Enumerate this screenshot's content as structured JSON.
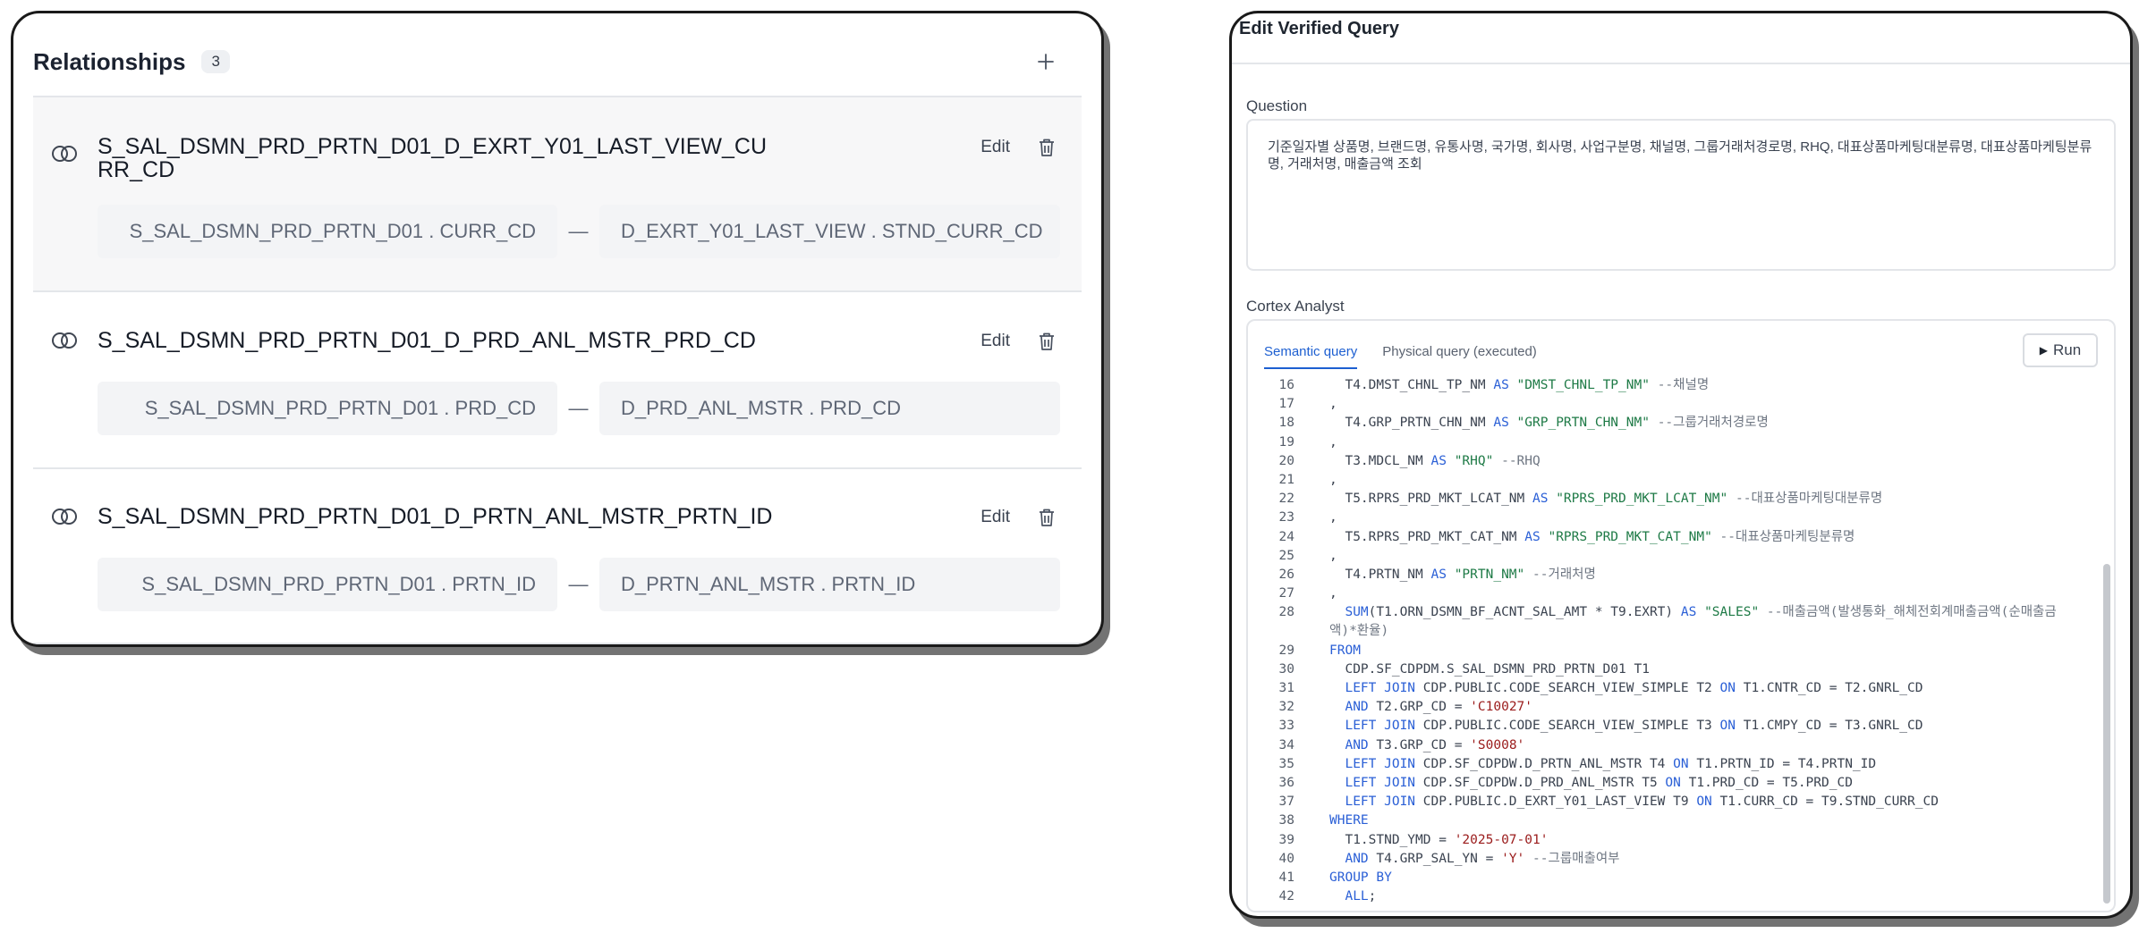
{
  "relationships": {
    "title": "Relationships",
    "count": "3",
    "items": [
      {
        "name": "S_SAL_DSMN_PRD_PRTN_D01_D_EXRT_Y01_LAST_VIEW_CURR_CD",
        "edit_label": "Edit",
        "left": "S_SAL_DSMN_PRD_PRTN_D01 . CURR_CD",
        "sep": "—",
        "right": "D_EXRT_Y01_LAST_VIEW . STND_CURR_CD"
      },
      {
        "name": "S_SAL_DSMN_PRD_PRTN_D01_D_PRD_ANL_MSTR_PRD_CD",
        "edit_label": "Edit",
        "left": "S_SAL_DSMN_PRD_PRTN_D01 . PRD_CD",
        "sep": "—",
        "right": "D_PRD_ANL_MSTR . PRD_CD"
      },
      {
        "name": "S_SAL_DSMN_PRD_PRTN_D01_D_PRTN_ANL_MSTR_PRTN_ID",
        "edit_label": "Edit",
        "left": "S_SAL_DSMN_PRD_PRTN_D01 . PRTN_ID",
        "sep": "—",
        "right": "D_PRTN_ANL_MSTR . PRTN_ID"
      }
    ]
  },
  "editor": {
    "title": "Edit Verified Query",
    "question_label": "Question",
    "question_text": "기준일자별 상품명, 브랜드명, 유통사명, 국가명, 회사명, 사업구분명, 채널명, 그룹거래처경로명, RHQ, 대표상품마케팅대분류명, 대표상품마케팅분류명, 거래처명, 매출금액 조회",
    "analyst_label": "Cortex Analyst",
    "tab_semantic": "Semantic query",
    "tab_physical": "Physical query (executed)",
    "run_label": "Run",
    "code_lines": [
      {
        "n": "16",
        "html": "  T4.DMST_CHNL_TP_NM <span class=\"kw\">AS</span> <span class=\"str\">\"DMST_CHNL_TP_NM\"</span> <span class=\"cmt\">--채널명</span>"
      },
      {
        "n": "17",
        "html": ","
      },
      {
        "n": "18",
        "html": "  T4.GRP_PRTN_CHN_NM <span class=\"kw\">AS</span> <span class=\"str\">\"GRP_PRTN_CHN_NM\"</span> <span class=\"cmt\">--그룹거래처경로명</span>"
      },
      {
        "n": "19",
        "html": ","
      },
      {
        "n": "20",
        "html": "  T3.MDCL_NM <span class=\"kw\">AS</span> <span class=\"str\">\"RHQ\"</span> <span class=\"cmt\">--RHQ</span>"
      },
      {
        "n": "21",
        "html": ","
      },
      {
        "n": "22",
        "html": "  T5.RPRS_PRD_MKT_LCAT_NM <span class=\"kw\">AS</span> <span class=\"str\">\"RPRS_PRD_MKT_LCAT_NM\"</span> <span class=\"cmt\">--대표상품마케팅대분류명</span>"
      },
      {
        "n": "23",
        "html": ","
      },
      {
        "n": "24",
        "html": "  T5.RPRS_PRD_MKT_CAT_NM <span class=\"kw\">AS</span> <span class=\"str\">\"RPRS_PRD_MKT_CAT_NM\"</span> <span class=\"cmt\">--대표상품마케팅분류명</span>"
      },
      {
        "n": "25",
        "html": ","
      },
      {
        "n": "26",
        "html": "  T4.PRTN_NM <span class=\"kw\">AS</span> <span class=\"str\">\"PRTN_NM\"</span> <span class=\"cmt\">--거래처명</span>"
      },
      {
        "n": "27",
        "html": ","
      },
      {
        "n": "28",
        "html": "  <span class=\"kw\">SUM</span>(T1.ORN_DSMN_BF_ACNT_SAL_AMT * T9.EXRT) <span class=\"kw\">AS</span> <span class=\"str\">\"SALES\"</span> <span class=\"cmt\">--매출금액(발생통화_해체전회계매출금액(순매출금액)*환율)</span>",
        "tall": true
      },
      {
        "n": "29",
        "html": "<span class=\"kw\">FROM</span>"
      },
      {
        "n": "30",
        "html": "  CDP.SF_CDPDM.S_SAL_DSMN_PRD_PRTN_D01 T1"
      },
      {
        "n": "31",
        "html": "  <span class=\"kw\">LEFT JOIN</span> CDP.PUBLIC.CODE_SEARCH_VIEW_SIMPLE T2 <span class=\"kw\">ON</span> T1.CNTR_CD = T2.GNRL_CD"
      },
      {
        "n": "32",
        "html": "  <span class=\"kw\">AND</span> T2.GRP_CD = <span class=\"dstr\">'C10027'</span>"
      },
      {
        "n": "33",
        "html": "  <span class=\"kw\">LEFT JOIN</span> CDP.PUBLIC.CODE_SEARCH_VIEW_SIMPLE T3 <span class=\"kw\">ON</span> T1.CMPY_CD = T3.GNRL_CD"
      },
      {
        "n": "34",
        "html": "  <span class=\"kw\">AND</span> T3.GRP_CD = <span class=\"dstr\">'S0008'</span>"
      },
      {
        "n": "35",
        "html": "  <span class=\"kw\">LEFT JOIN</span> CDP.SF_CDPDW.D_PRTN_ANL_MSTR T4 <span class=\"kw\">ON</span> T1.PRTN_ID = T4.PRTN_ID"
      },
      {
        "n": "36",
        "html": "  <span class=\"kw\">LEFT JOIN</span> CDP.SF_CDPDW.D_PRD_ANL_MSTR T5 <span class=\"kw\">ON</span> T1.PRD_CD = T5.PRD_CD"
      },
      {
        "n": "37",
        "html": "  <span class=\"kw\">LEFT JOIN</span> CDP.PUBLIC.D_EXRT_Y01_LAST_VIEW T9 <span class=\"kw\">ON</span> T1.CURR_CD = T9.STND_CURR_CD"
      },
      {
        "n": "38",
        "html": "<span class=\"kw\">WHERE</span>"
      },
      {
        "n": "39",
        "html": "  T1.STND_YMD = <span class=\"dstr\">'2025-07-01'</span>"
      },
      {
        "n": "40",
        "html": "  <span class=\"kw\">AND</span> T4.GRP_SAL_YN = <span class=\"dstr\">'Y'</span> <span class=\"cmt\">--그룹매출여부</span>"
      },
      {
        "n": "41",
        "html": "<span class=\"kw\">GROUP BY</span>"
      },
      {
        "n": "42",
        "html": "  <span class=\"kw\">ALL</span>;"
      }
    ]
  },
  "colors": {
    "keyword": "#2a5fd6",
    "string": "#1e7a46",
    "literal": "#9a1b1b",
    "comment": "#6f7783",
    "tab_active": "#1d5fd1"
  },
  "icons": {
    "relationship": "linked-circles-icon",
    "delete": "trash-icon",
    "add": "plus-icon",
    "run": "play-icon"
  }
}
